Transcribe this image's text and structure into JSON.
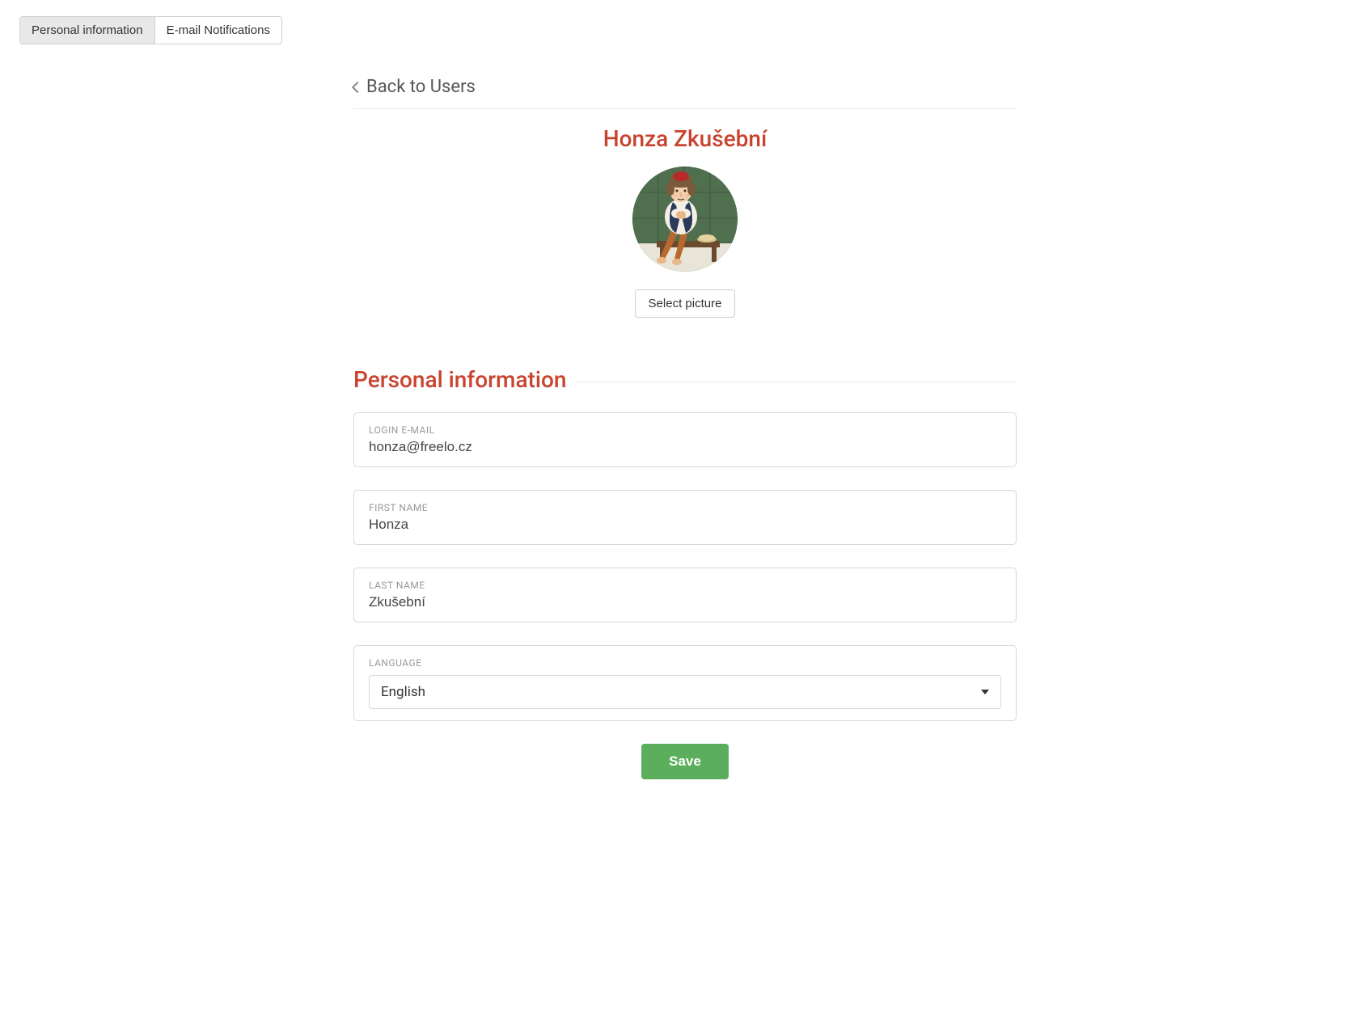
{
  "tabs": {
    "personal_info": "Personal information",
    "email_notifications": "E-mail Notifications"
  },
  "back_link": "Back to Users",
  "user": {
    "display_name": "Honza Zkušební"
  },
  "buttons": {
    "select_picture": "Select picture",
    "save": "Save"
  },
  "section": {
    "title": "Personal information"
  },
  "fields": {
    "login_email": {
      "label": "LOGIN E-MAIL",
      "value": "honza@freelo.cz"
    },
    "first_name": {
      "label": "FIRST NAME",
      "value": "Honza"
    },
    "last_name": {
      "label": "LAST NAME",
      "value": "Zkušební"
    },
    "language": {
      "label": "LANGUAGE",
      "value": "English"
    }
  }
}
